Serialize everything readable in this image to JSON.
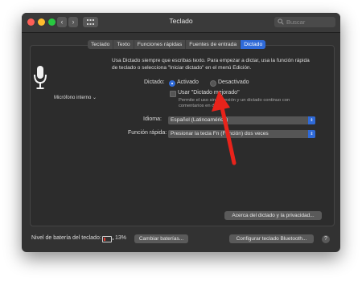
{
  "window": {
    "title": "Teclado",
    "search_placeholder": "Buscar"
  },
  "tabs": [
    {
      "label": "Teclado",
      "active": false
    },
    {
      "label": "Texto",
      "active": false
    },
    {
      "label": "Funciones rápidas",
      "active": false
    },
    {
      "label": "Fuentes de entrada",
      "active": false
    },
    {
      "label": "Dictado",
      "active": true
    }
  ],
  "microphone": {
    "label": "Micrófono interno ⌄"
  },
  "description": "Usa Dictado siempre que escribas texto. Para empezar a dictar, usa la función rápida de teclado o selecciona \"Iniciar dictado\" en el menú Edición.",
  "dictation": {
    "label": "Dictado:",
    "on_label": "Activado",
    "off_label": "Desactivado",
    "selected": "Activado"
  },
  "enhanced": {
    "label": "Usar \"Dictado mejorado\"",
    "checked": false,
    "sublabel": "Permite el uso sin conexión y un dictado continuo con comentarios en directo."
  },
  "language": {
    "label": "Idioma:",
    "value": "Español (Latinoamérica)"
  },
  "shortcut": {
    "label": "Función rápida:",
    "value": "Presionar la tecla Fn (Función) dos veces"
  },
  "about_button": "Acerca del dictado y la privacidad...",
  "footer": {
    "battery_label": "Nivel de batería del teclado:",
    "battery_percent": "13%",
    "change_batteries": "Cambiar baterías...",
    "bluetooth_button": "Configurar teclado Bluetooth...",
    "help": "?"
  },
  "colors": {
    "accent": "#2f6ad8",
    "annotation_arrow": "#e8231b",
    "battery_low": "#e23a2f"
  }
}
